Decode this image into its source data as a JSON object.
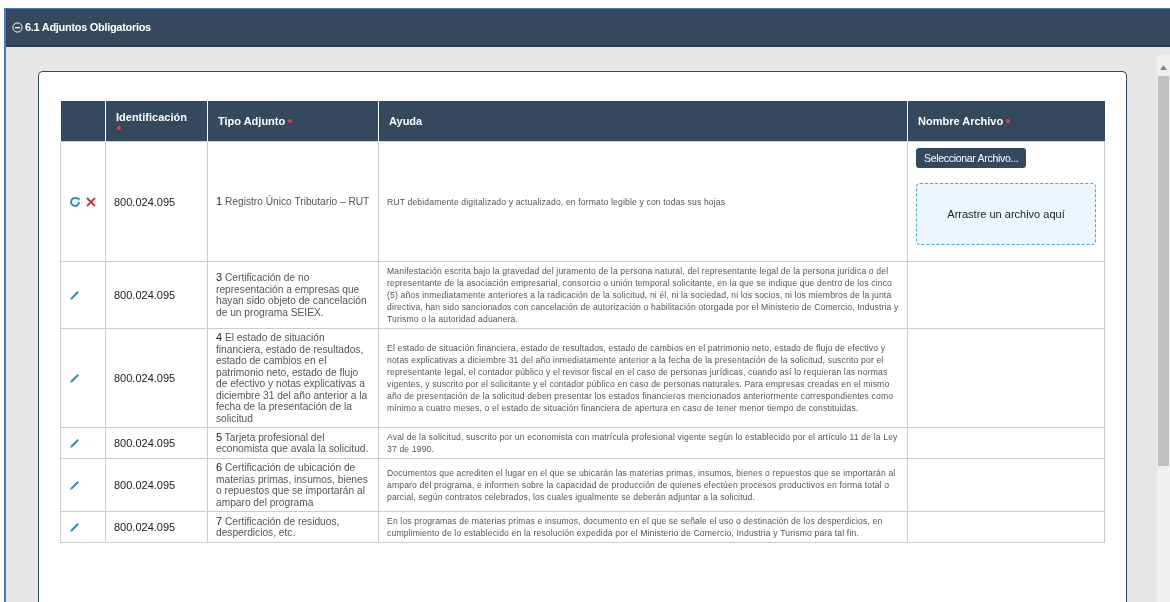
{
  "section": {
    "title": "6.1 Adjuntos Obligatorios",
    "expanded": true
  },
  "table": {
    "columns": [
      {
        "label": "Identificación",
        "required": true,
        "stacked": true
      },
      {
        "label": "Tipo Adjunto",
        "required": true
      },
      {
        "label": "Ayuda",
        "required": false
      },
      {
        "label": "Nombre Archivo",
        "required": true
      }
    ],
    "rows": [
      {
        "kind": "upload",
        "identificacion": "800.024.095",
        "number": "1",
        "title": "Registro Único Tributario – RUT",
        "ayuda": "RUT debidamente digitalizado y actualizado, en formato legible y con todas sus hojas",
        "file_button": "Seleccionar Archivo...",
        "drop_zone": "Arrastre un archivo aquí"
      },
      {
        "kind": "edit",
        "identificacion": "800.024.095",
        "number": "3",
        "title": "Certificación de no representación a empresas que hayan sido objeto de cancelación de un programa SEIEX.",
        "ayuda": "Manifestación escrita bajo la gravedad del juramento de la persona natural, del representante legal de la persona jurídica o del representante de la asociación empresarial, consorcio o unión temporal solicitante, en la que se indique que dentro de los cinco (5) años inmediatamente anteriores a la radicación de la solicitud, ni él, ni la sociedad, ni los socios, ni los miembros de la junta directiva, han sido sancionados con cancelación de autorización o habilitación otorgada por el Ministerio de Comercio, Industria y Turismo o la autoridad aduanera."
      },
      {
        "kind": "edit",
        "identificacion": "800.024.095",
        "number": "4",
        "title": "El estado de situación financiera, estado de resultados, estado de cambios en el patrimonio neto, estado de flujo de efectivo y notas explicativas a diciembre 31 del año anterior a la fecha de la presentación de la solicitud",
        "ayuda": "El estado de situación financiera, estado de resultados, estado de cambios en el patrimonio neto, estado de flujo de efectivo y notas explicativas a diciembre 31 del año inmediatamente anterior a la fecha de la presentación de la solicitud, suscrito por el representante legal, el contador público y el revisor fiscal en el caso de personas jurídicas, cuando así lo requieran las normas vigentes, y suscrito por el solicitante y el contador público en caso de personas naturales. Para empresas creadas en el mismo año de presentación de la solicitud deben presentar los estados financieros mencionados anteriormente correspondientes como mínimo a cuatro meses, o el estado de situación financiera de apertura en caso de tener menor tiempo de constituidas."
      },
      {
        "kind": "edit",
        "identificacion": "800.024.095",
        "number": "5",
        "title": "Tarjeta profesional del economista que avala la solicitud.",
        "ayuda": "Aval de la solicitud, suscrito por un economista con matrícula profesional vigente según lo establecido por el artículo 11 de la Ley 37 de 1990."
      },
      {
        "kind": "edit",
        "identificacion": "800.024.095",
        "number": "6",
        "title": "Certificación de ubicación de materias primas, insumos, bienes o repuestos que se importarán al amparo del programa",
        "ayuda": "Documentos que acrediten el lugar en el que se ubicarán las materias primas, insumos, bienes o repuestos que se importarán al amparo del programa, e informen sobre la capacidad de producción de quienes efectúen procesos productivos en forma total o parcial, según contratos celebrados, los cuales igualmente se deberán adjuntar a la solicitud."
      },
      {
        "kind": "edit",
        "identificacion": "800.024.095",
        "number": "7",
        "title": "Certificación de residuos, desperdicios, etc.",
        "ayuda": "En los programas de materias primas e insumos, documento en el que se señale el uso o destinación de los desperdicios, en cumplimiento de lo establecido en la resolución expedida por el Ministerio de Comercio, Industria y Turismo para tal fin."
      }
    ]
  }
}
